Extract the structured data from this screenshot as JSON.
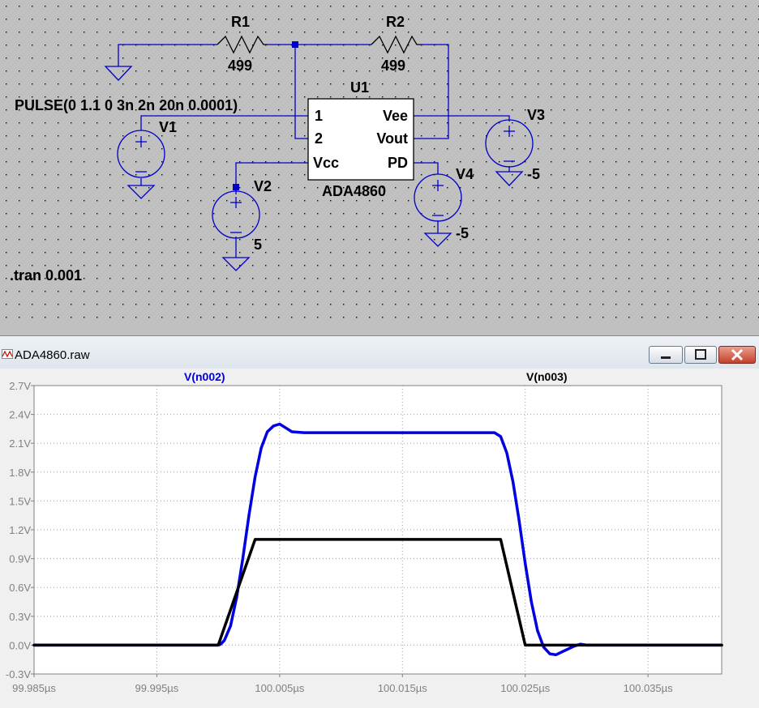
{
  "schematic": {
    "r1": {
      "name": "R1",
      "value": "499"
    },
    "r2": {
      "name": "R2",
      "value": "499"
    },
    "u1": {
      "name": "U1",
      "part": "ADA4860",
      "pins": {
        "in1": "1",
        "in2": "2",
        "vcc": "Vcc",
        "vee": "Vee",
        "vout": "Vout",
        "pd": "PD"
      }
    },
    "v1": {
      "name": "V1",
      "value": "PULSE(0 1.1 0 3n 2n 20n 0.0001)"
    },
    "v2": {
      "name": "V2",
      "value": "5"
    },
    "v3": {
      "name": "V3",
      "value": "-5"
    },
    "v4": {
      "name": "V4",
      "value": "-5"
    },
    "directive": ".tran 0.001"
  },
  "window": {
    "title": "ADA4860.raw"
  },
  "chart_data": {
    "type": "line",
    "x_unit": "µs",
    "xlim": [
      99.985,
      100.041
    ],
    "x_ticks": [
      "99.985µs",
      "99.995µs",
      "100.005µs",
      "100.015µs",
      "100.025µs",
      "100.035µs"
    ],
    "x_tick_values": [
      99.985,
      99.995,
      100.005,
      100.015,
      100.025,
      100.035
    ],
    "ylim": [
      -0.3,
      2.7
    ],
    "y_ticks": [
      "2.7V",
      "2.4V",
      "2.1V",
      "1.8V",
      "1.5V",
      "1.2V",
      "0.9V",
      "0.6V",
      "0.3V",
      "0.0V",
      "-0.3V"
    ],
    "y_tick_values": [
      2.7,
      2.4,
      2.1,
      1.8,
      1.5,
      1.2,
      0.9,
      0.6,
      0.3,
      0.0,
      -0.3
    ],
    "grid": true,
    "series": [
      {
        "name": "V(n002)",
        "color": "#0000e0",
        "x": [
          99.985,
          100.0,
          100.0002,
          100.0005,
          100.001,
          100.0015,
          100.002,
          100.0025,
          100.003,
          100.0035,
          100.004,
          100.0045,
          100.005,
          100.0055,
          100.006,
          100.007,
          100.008,
          100.01,
          100.015,
          100.02,
          100.0225,
          100.023,
          100.0235,
          100.024,
          100.0245,
          100.025,
          100.0255,
          100.026,
          100.0265,
          100.027,
          100.0275,
          100.028,
          100.029,
          100.0295,
          100.03,
          100.041
        ],
        "y": [
          0.0,
          0.0,
          0.01,
          0.05,
          0.2,
          0.5,
          0.9,
          1.35,
          1.75,
          2.05,
          2.22,
          2.28,
          2.3,
          2.26,
          2.22,
          2.21,
          2.21,
          2.21,
          2.21,
          2.21,
          2.21,
          2.17,
          2.0,
          1.7,
          1.3,
          0.85,
          0.45,
          0.15,
          -0.02,
          -0.09,
          -0.1,
          -0.07,
          -0.01,
          0.01,
          0.0,
          0.0
        ]
      },
      {
        "name": "V(n003)",
        "color": "#000000",
        "x": [
          99.985,
          100.0,
          100.003,
          100.005,
          100.023,
          100.025,
          100.041
        ],
        "y": [
          0.0,
          0.0,
          1.1,
          1.1,
          1.1,
          0.0,
          0.0
        ]
      }
    ]
  }
}
